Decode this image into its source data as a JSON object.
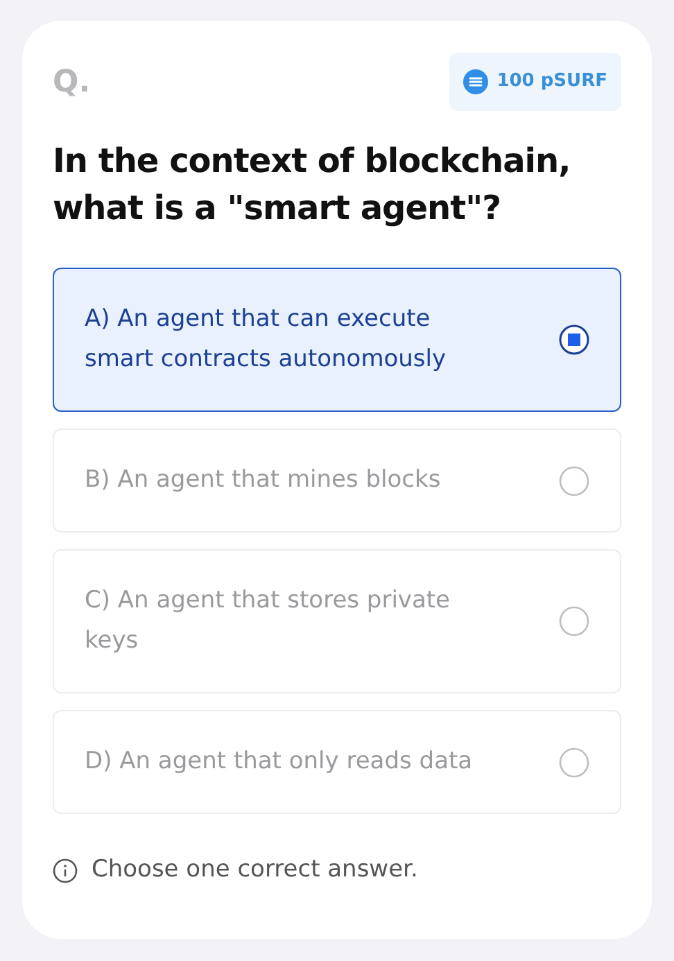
{
  "label": "Q.",
  "reward": {
    "text": "100 pSURF"
  },
  "question": "In the context of blockchain, what is a \"smart agent\"?",
  "options": [
    {
      "text": "A) An agent that can execute smart contracts autonomously",
      "selected": true
    },
    {
      "text": "B) An agent that mines blocks",
      "selected": false
    },
    {
      "text": "C) An agent that stores private keys",
      "selected": false
    },
    {
      "text": "D) An agent that only reads data",
      "selected": false
    }
  ],
  "hint": "Choose one correct answer."
}
